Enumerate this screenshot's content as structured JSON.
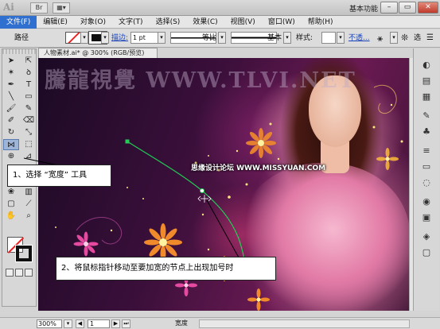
{
  "title_bar": {
    "app_logo": "Ai",
    "workspace": "基本功能",
    "buttons": [
      "minimize",
      "restore",
      "close"
    ]
  },
  "menu": {
    "items": [
      "文件(F)",
      "编辑(E)",
      "对象(O)",
      "文字(T)",
      "选择(S)",
      "效果(C)",
      "视图(V)",
      "窗口(W)",
      "帮助(H)"
    ]
  },
  "control_bar": {
    "path_label": "路径",
    "stroke_label": "描边:",
    "stroke_weight": "1 pt",
    "profile_label": "等比",
    "brush_label": "基本",
    "opacity_label": "样式:",
    "opacity_link": "不透...",
    "extra": "选"
  },
  "document": {
    "tab_title": "人物素材.ai* @ 300% (RGB/预览)",
    "watermark": "騰龍視覺 WWW.TLVI.NET",
    "site_credit": "思缘设计论坛  WWW.MISSYUAN.COM"
  },
  "callouts": {
    "step1": "1、选择 “宽度” 工具",
    "step2": "2、将鼠标指针移动至要加宽的节点上出现加号时"
  },
  "status_bar": {
    "zoom": "300%",
    "page": "1",
    "tool_name": "宽度"
  },
  "colors": {
    "menu_highlight": "#2f6fcf",
    "path_stroke": "#22cc55",
    "stroke_none_slash": "#e22222"
  },
  "tools": {
    "icons": [
      "selection-icon",
      "direct-selection-icon",
      "magic-wand-icon",
      "lasso-icon",
      "pen-icon",
      "type-icon",
      "line-icon",
      "rectangle-icon",
      "paintbrush-icon",
      "pencil-icon",
      "blob-brush-icon",
      "eraser-icon",
      "rotate-icon",
      "scale-icon",
      "width-icon",
      "free-transform-icon",
      "shape-builder-icon",
      "perspective-icon",
      "mesh-icon",
      "gradient-icon",
      "eyedropper-icon",
      "blend-icon",
      "symbol-sprayer-icon",
      "column-graph-icon",
      "artboard-icon",
      "slice-icon",
      "hand-icon",
      "zoom-icon"
    ]
  }
}
